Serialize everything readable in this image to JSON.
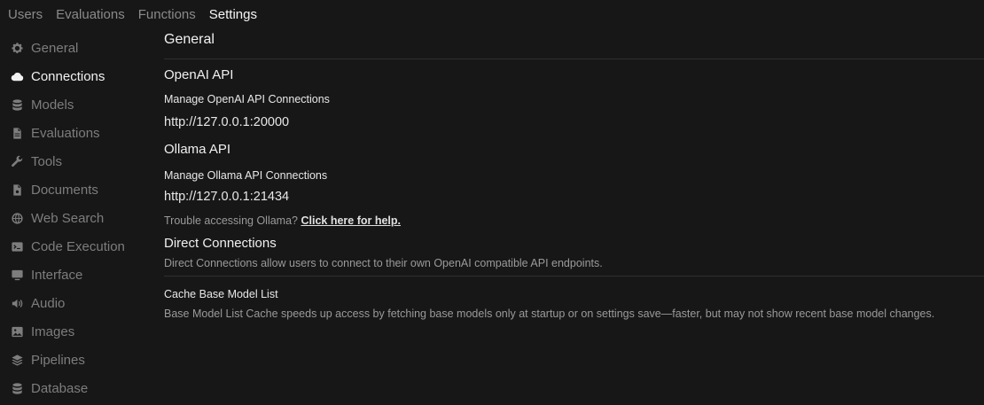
{
  "top_tabs": [
    {
      "label": "Users"
    },
    {
      "label": "Evaluations"
    },
    {
      "label": "Functions"
    },
    {
      "label": "Settings"
    }
  ],
  "sidebar": {
    "items": [
      {
        "label": "General",
        "icon": "gear-icon"
      },
      {
        "label": "Connections",
        "icon": "cloud-icon"
      },
      {
        "label": "Models",
        "icon": "database-icon"
      },
      {
        "label": "Evaluations",
        "icon": "document-icon"
      },
      {
        "label": "Tools",
        "icon": "wrench-icon"
      },
      {
        "label": "Documents",
        "icon": "document-icon"
      },
      {
        "label": "Web Search",
        "icon": "globe-icon"
      },
      {
        "label": "Code Execution",
        "icon": "terminal-icon"
      },
      {
        "label": "Interface",
        "icon": "monitor-icon"
      },
      {
        "label": "Audio",
        "icon": "speaker-icon"
      },
      {
        "label": "Images",
        "icon": "image-icon"
      },
      {
        "label": "Pipelines",
        "icon": "layers-icon"
      },
      {
        "label": "Database",
        "icon": "database-icon"
      }
    ],
    "active": "Connections"
  },
  "main": {
    "title": "General",
    "openai": {
      "title": "OpenAI API",
      "manage_label": "Manage OpenAI API Connections",
      "url": "http://127.0.0.1:20000"
    },
    "ollama": {
      "title": "Ollama API",
      "manage_label": "Manage Ollama API Connections",
      "url": "http://127.0.0.1:21434",
      "help_text": "Trouble accessing Ollama?",
      "help_link": "Click here for help."
    },
    "direct": {
      "title": "Direct Connections",
      "description": "Direct Connections allow users to connect to their own OpenAI compatible API endpoints."
    },
    "cache": {
      "title": "Cache Base Model List",
      "description": "Base Model List Cache speeds up access by fetching base models only at startup or on settings save—faster, but may not show recent base model changes."
    }
  }
}
